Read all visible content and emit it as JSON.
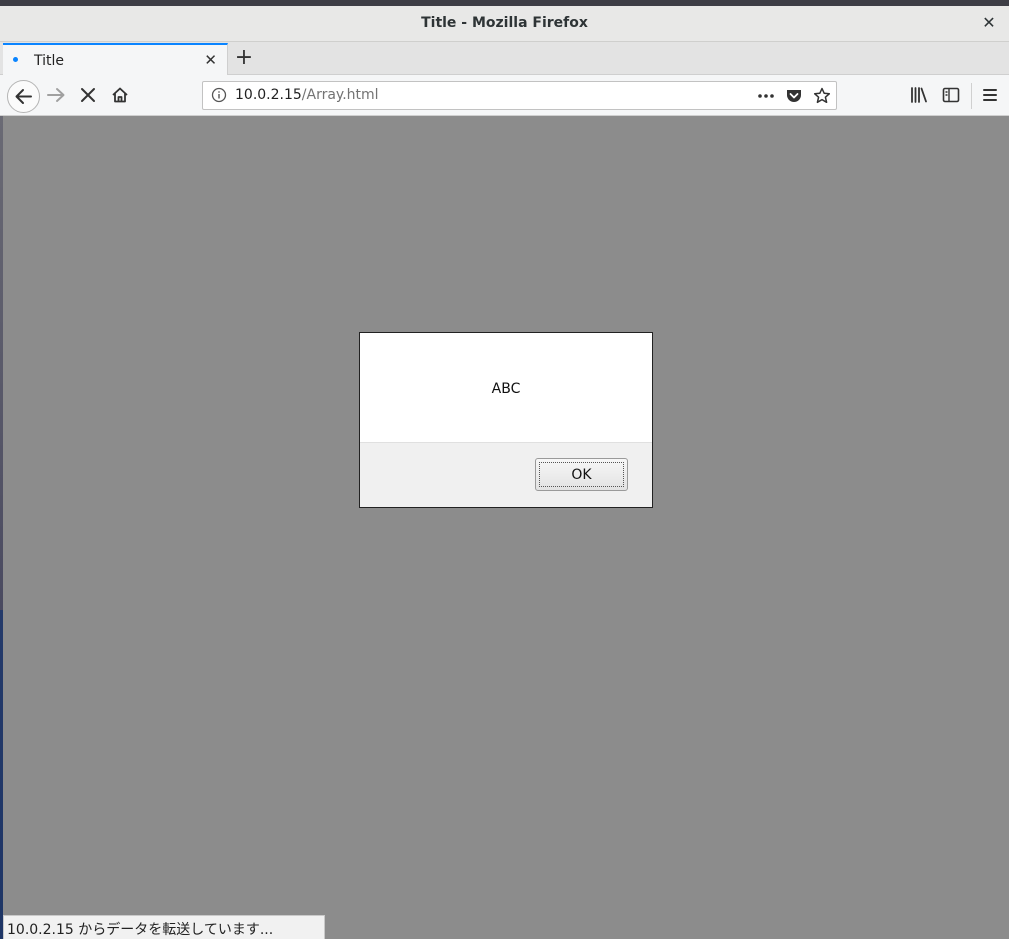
{
  "window": {
    "title": "Title - Mozilla Firefox",
    "close_glyph": "✕"
  },
  "tabs": [
    {
      "title": "Title",
      "close_glyph": "✕"
    }
  ],
  "new_tab_glyph": "+",
  "urlbar": {
    "host": "10.0.2.15",
    "path": "/Array.html"
  },
  "dialog": {
    "message": "ABC",
    "ok_label": "OK"
  },
  "status": {
    "text": "10.0.2.15 からデータを転送しています..."
  },
  "colors": {
    "accent": "#0a84ff",
    "content_overlay": "#8c8c8c"
  }
}
